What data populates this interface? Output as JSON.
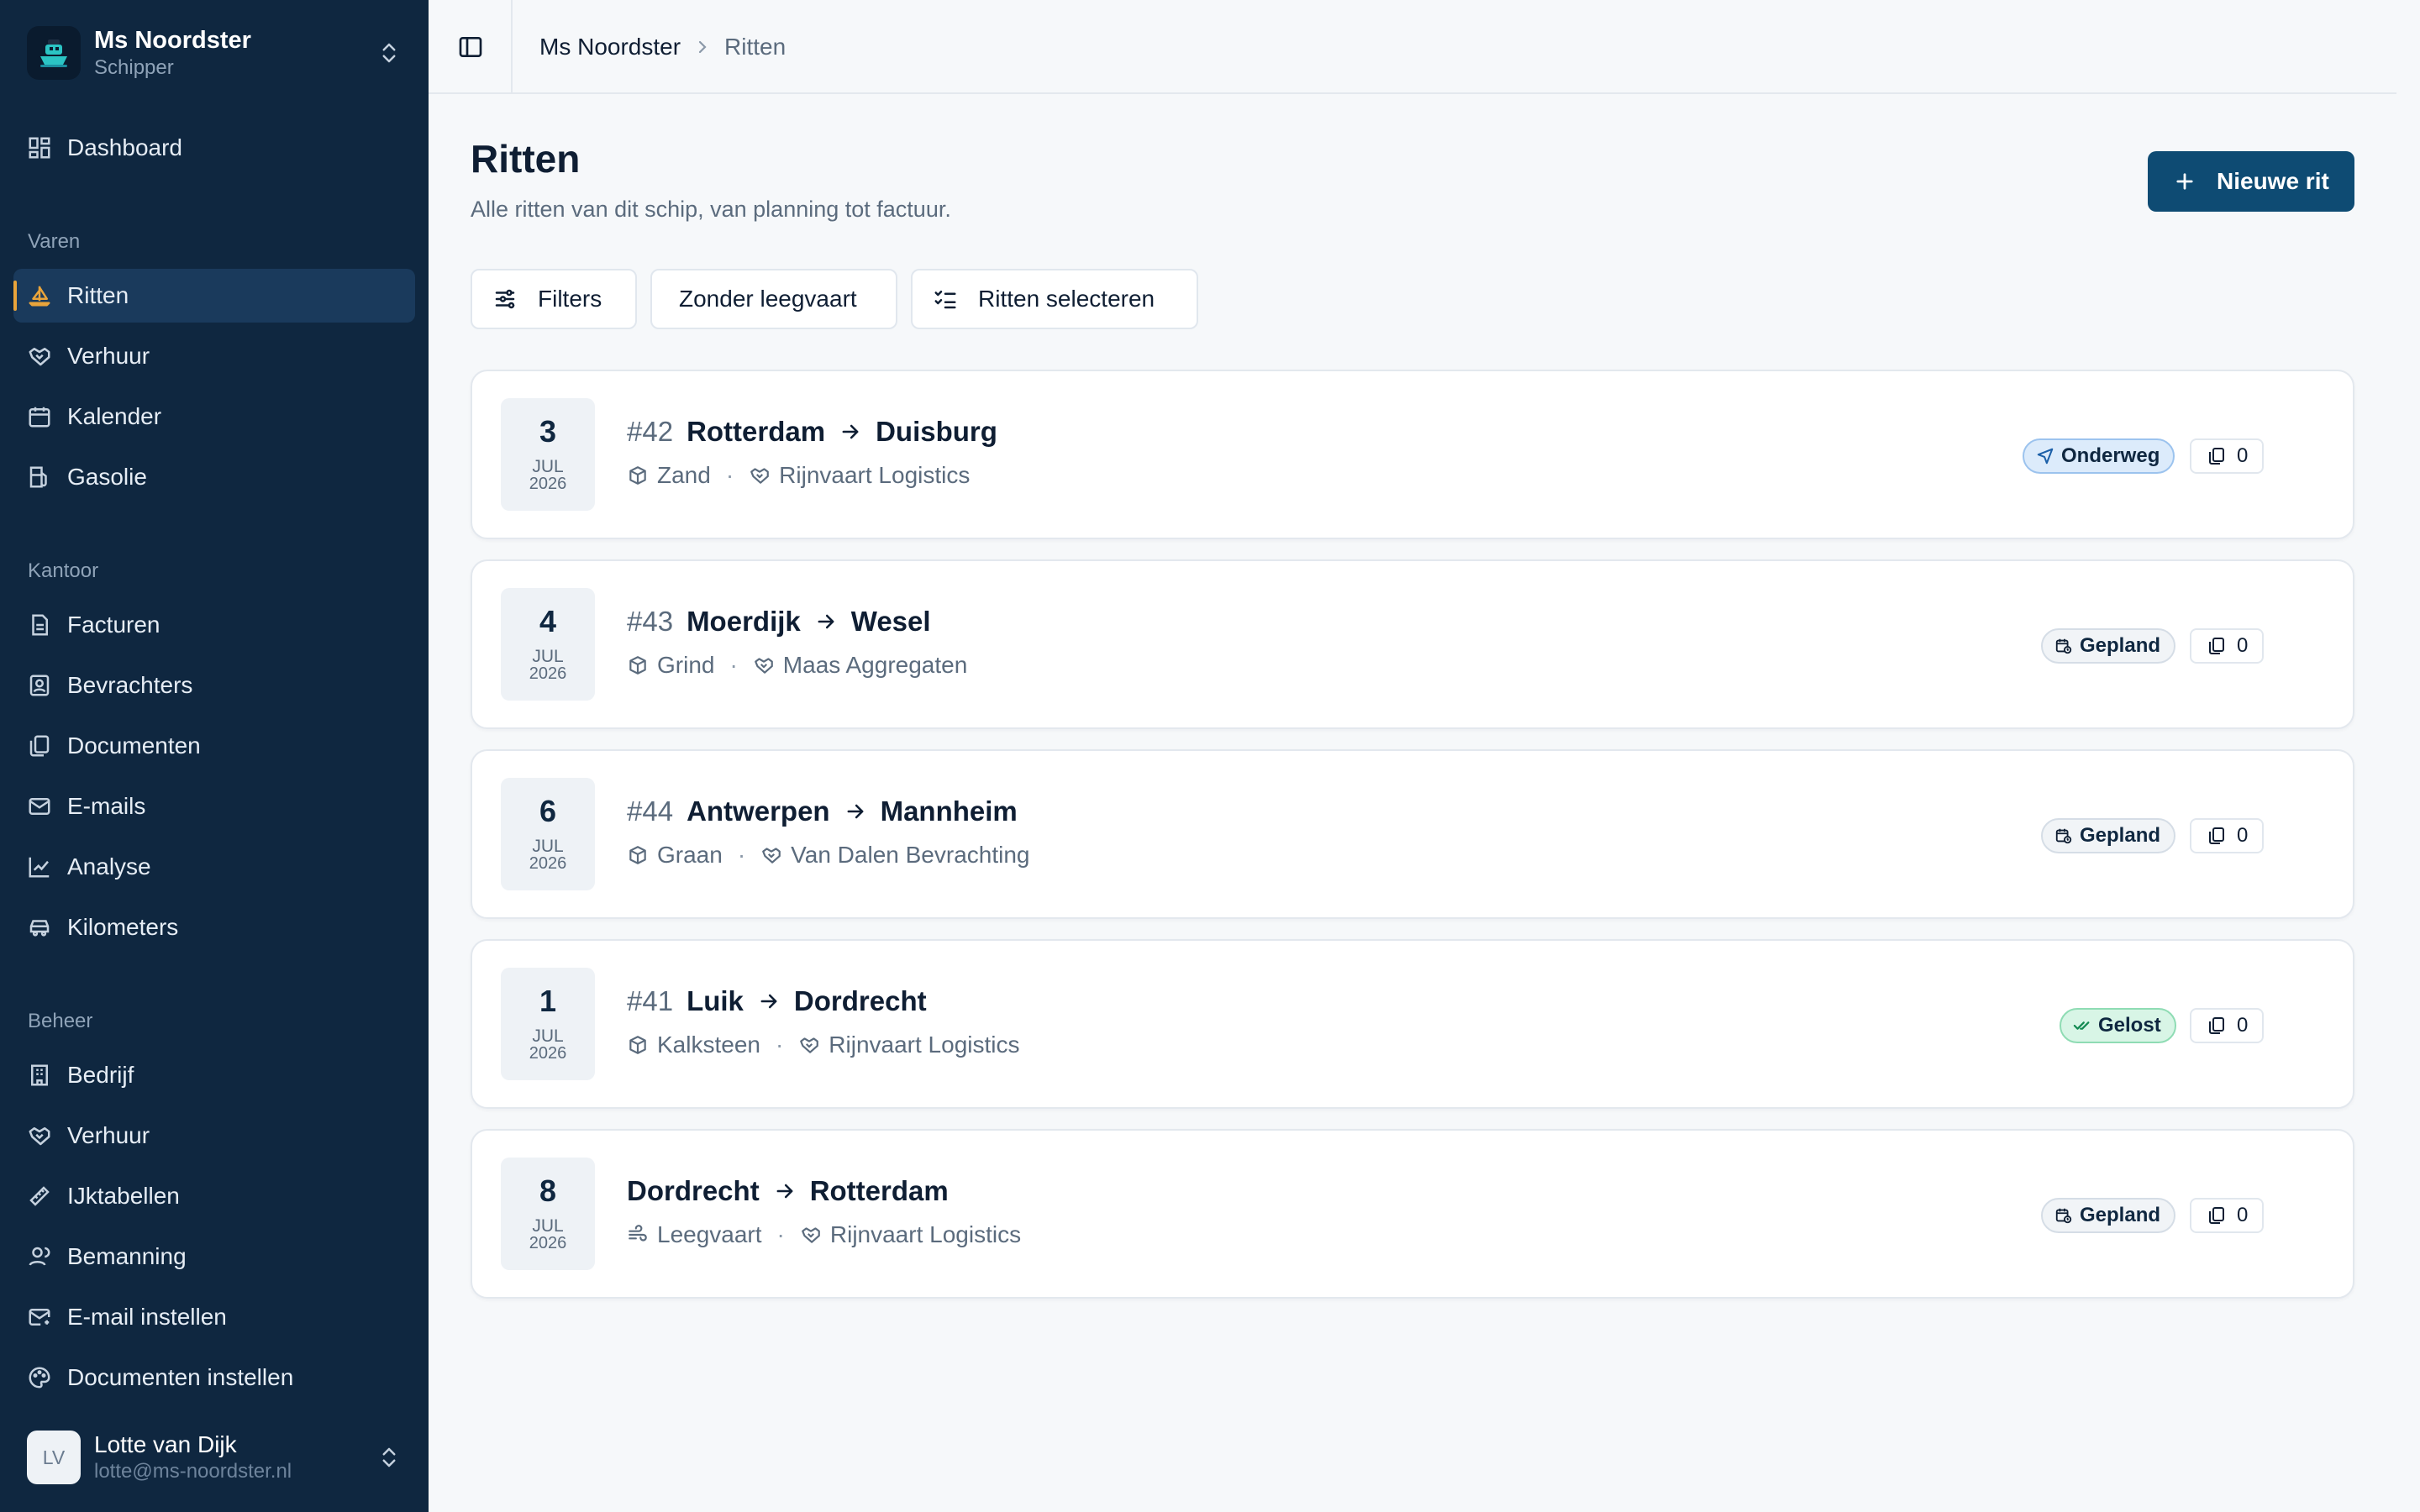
{
  "workspace": {
    "name": "Ms Noordster",
    "role": "Schipper"
  },
  "nav": {
    "dashboard": "Dashboard",
    "sections": {
      "varen": "Varen",
      "kantoor": "Kantoor",
      "beheer": "Beheer"
    },
    "varen_items": [
      "Ritten",
      "Verhuur",
      "Kalender",
      "Gasolie"
    ],
    "kantoor_items": [
      "Facturen",
      "Bevrachters",
      "Documenten",
      "E-mails",
      "Analyse",
      "Kilometers"
    ],
    "beheer_items": [
      "Bedrijf",
      "Verhuur",
      "IJktabellen",
      "Bemanning",
      "E-mail instellen",
      "Documenten instellen"
    ]
  },
  "user": {
    "initials": "LV",
    "name": "Lotte van Dijk",
    "email": "lotte@ms-noordster.nl"
  },
  "breadcrumb": {
    "root": "Ms Noordster",
    "current": "Ritten"
  },
  "page": {
    "title": "Ritten",
    "subtitle": "Alle ritten van dit schip, van planning tot factuur.",
    "new_button": "Nieuwe rit"
  },
  "filters": {
    "filters": "Filters",
    "zonder_leegvaart": "Zonder leegvaart",
    "select": "Ritten selecteren"
  },
  "trips": [
    {
      "day": "3",
      "month": "JUL",
      "year": "2026",
      "number": "#42",
      "from": "Rotterdam",
      "to": "Duisburg",
      "cargo": "Zand",
      "charterer": "Rijnvaart Logistics",
      "status": "Onderweg",
      "docs": "0"
    },
    {
      "day": "4",
      "month": "JUL",
      "year": "2026",
      "number": "#43",
      "from": "Moerdijk",
      "to": "Wesel",
      "cargo": "Grind",
      "charterer": "Maas Aggregaten",
      "status": "Gepland",
      "docs": "0"
    },
    {
      "day": "6",
      "month": "JUL",
      "year": "2026",
      "number": "#44",
      "from": "Antwerpen",
      "to": "Mannheim",
      "cargo": "Graan",
      "charterer": "Van Dalen Bevrachting",
      "status": "Gepland",
      "docs": "0"
    },
    {
      "day": "1",
      "month": "JUL",
      "year": "2026",
      "number": "#41",
      "from": "Luik",
      "to": "Dordrecht",
      "cargo": "Kalksteen",
      "charterer": "Rijnvaart Logistics",
      "status": "Gelost",
      "docs": "0"
    },
    {
      "day": "8",
      "month": "JUL",
      "year": "2026",
      "number": "",
      "from": "Dordrecht",
      "to": "Rotterdam",
      "cargo": "Leegvaart",
      "charterer": "Rijnvaart Logistics",
      "status": "Gepland",
      "docs": "0"
    }
  ],
  "colors": {
    "sidebar_bg": "#0f2740",
    "active_item_bg": "#1a3a5c",
    "active_indicator": "#e9a43b",
    "primary_button": "#0e4b73",
    "status_onderweg": "#dcebfb",
    "status_gepland": "#f1f4f7",
    "status_gelost": "#d8f5e6"
  }
}
